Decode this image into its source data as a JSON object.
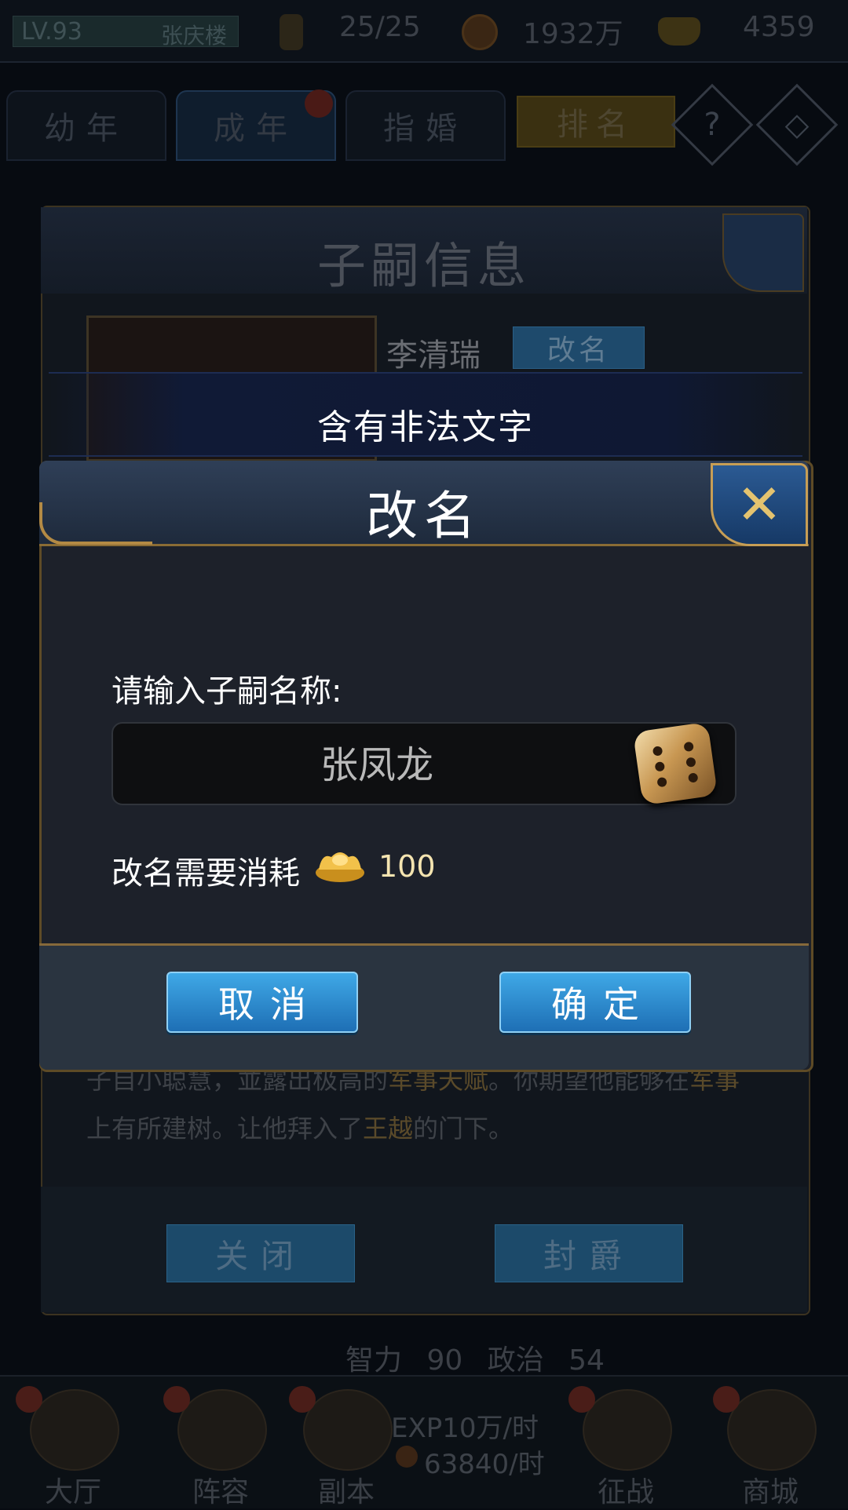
{
  "top_bar": {
    "level": "LV.93",
    "player_name": "张庆楼",
    "stamina": "25/25",
    "silver": "1932万",
    "gold": "4359"
  },
  "tabs": [
    {
      "label": "幼年"
    },
    {
      "label": "成年"
    },
    {
      "label": "指婚"
    },
    {
      "label": "排名"
    }
  ],
  "help_icon": "?",
  "background_panel": {
    "title": "子嗣信息",
    "child_name": "李清瑞",
    "rename_label": "改名",
    "story_line1_a": "子自小聪慧，並露出极高的",
    "story_line1_hl": "军事天赋",
    "story_line1_b": "。你期望他能够在",
    "story_line1_hl2": "军事",
    "story_line2_a": "上有所建树。让他拜入了",
    "story_line2_hl": "王越",
    "story_line2_b": "的门下。",
    "close_label": "关闭",
    "ennoble_label": "封爵",
    "stats": "智力 90   政治 54"
  },
  "toast": {
    "message": "含有非法文字"
  },
  "dialog": {
    "title": "改名",
    "close_icon": "close-x",
    "prompt": "请输入子嗣名称:",
    "name_value": "张凤龙",
    "cost_label": "改名需要消耗",
    "cost_value": "100",
    "cancel_label": "取消",
    "confirm_label": "确定"
  },
  "bottom_nav": {
    "items": [
      {
        "label": "大厅"
      },
      {
        "label": "阵容"
      },
      {
        "label": "副本"
      },
      {
        "label": "征战"
      },
      {
        "label": "商城"
      }
    ],
    "exp_rate": "EXP10万/时",
    "silver_rate": "63840/时"
  }
}
